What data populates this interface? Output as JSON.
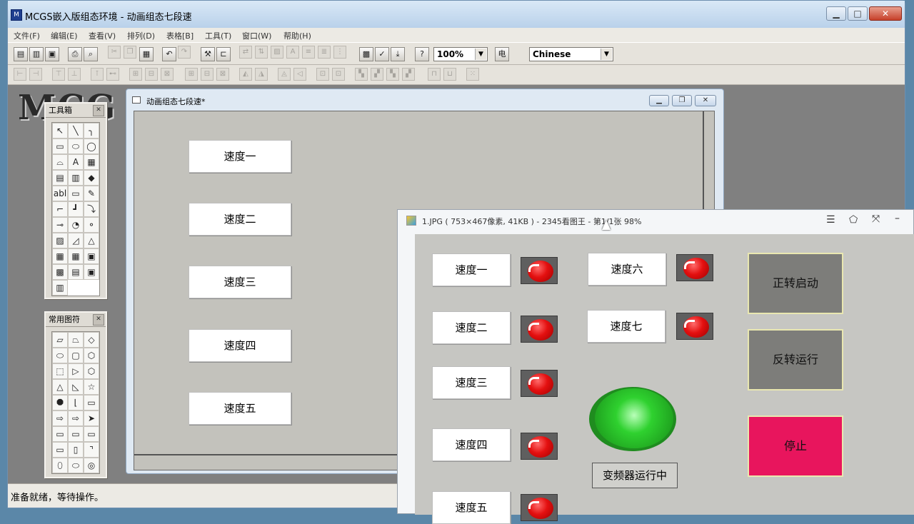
{
  "main": {
    "title": "MCGS嵌入版组态环境 - 动画组态七段速",
    "caption": {
      "minimize": "▁",
      "maximize": "□",
      "close": "✕"
    },
    "menus": [
      "文件(F)",
      "编辑(E)",
      "查看(V)",
      "排列(D)",
      "表格[B]",
      "工具(T)",
      "窗口(W)",
      "帮助(H)"
    ],
    "zoom": "100%",
    "zoom_icon": "电",
    "language": "Chinese",
    "logo": "MCG",
    "status": "准备就绪，等待操作。"
  },
  "toolbox": {
    "title": "工具箱",
    "tools": [
      "↖",
      "╲",
      "╮",
      "▭",
      "⬭",
      "◯",
      "⌓",
      "A",
      "▦",
      "▤",
      "▥",
      "◆",
      "abl",
      "▭",
      "✎",
      "⌐",
      "┛",
      "⤵",
      "⊸",
      "◔",
      "⚬",
      "▨",
      "◿",
      "△",
      "▦",
      "▦",
      "▣",
      "▩",
      "▤",
      "▣",
      "▥"
    ]
  },
  "symbols": {
    "title": "常用图符",
    "shapes": [
      "▱",
      "⏢",
      "◇",
      "⬭",
      "▢",
      "⬡",
      "⬚",
      "▷",
      "⬡",
      "△",
      "◺",
      "☆",
      "⯃",
      "⌊",
      "▭",
      "⇨",
      "⇨",
      "➤",
      "▭",
      "▭",
      "▭",
      "▭",
      "▯",
      "⌝",
      "⬯",
      "⬭",
      "◎"
    ]
  },
  "editor": {
    "title": "动画组态七段速*",
    "buttons": [
      "速度一",
      "速度二",
      "速度三",
      "速度四",
      "速度五"
    ]
  },
  "viewer": {
    "title": "1.JPG ( 753×467像素, 41KB ) - 2345看图王 - 第1/1张 98%",
    "speeds_left": [
      "速度一",
      "速度二",
      "速度三",
      "速度四",
      "速度五"
    ],
    "speeds_right": [
      "速度六",
      "速度七"
    ],
    "forward": "正转启动",
    "reverse": "反转运行",
    "stop": "停止",
    "running_label": "变频器运行中",
    "colors": {
      "forward_bg": "#7d7d7a",
      "reverse_bg": "#7d7d7a",
      "stop_bg": "#e8155d",
      "run_lamp": "#2fd12f"
    }
  }
}
